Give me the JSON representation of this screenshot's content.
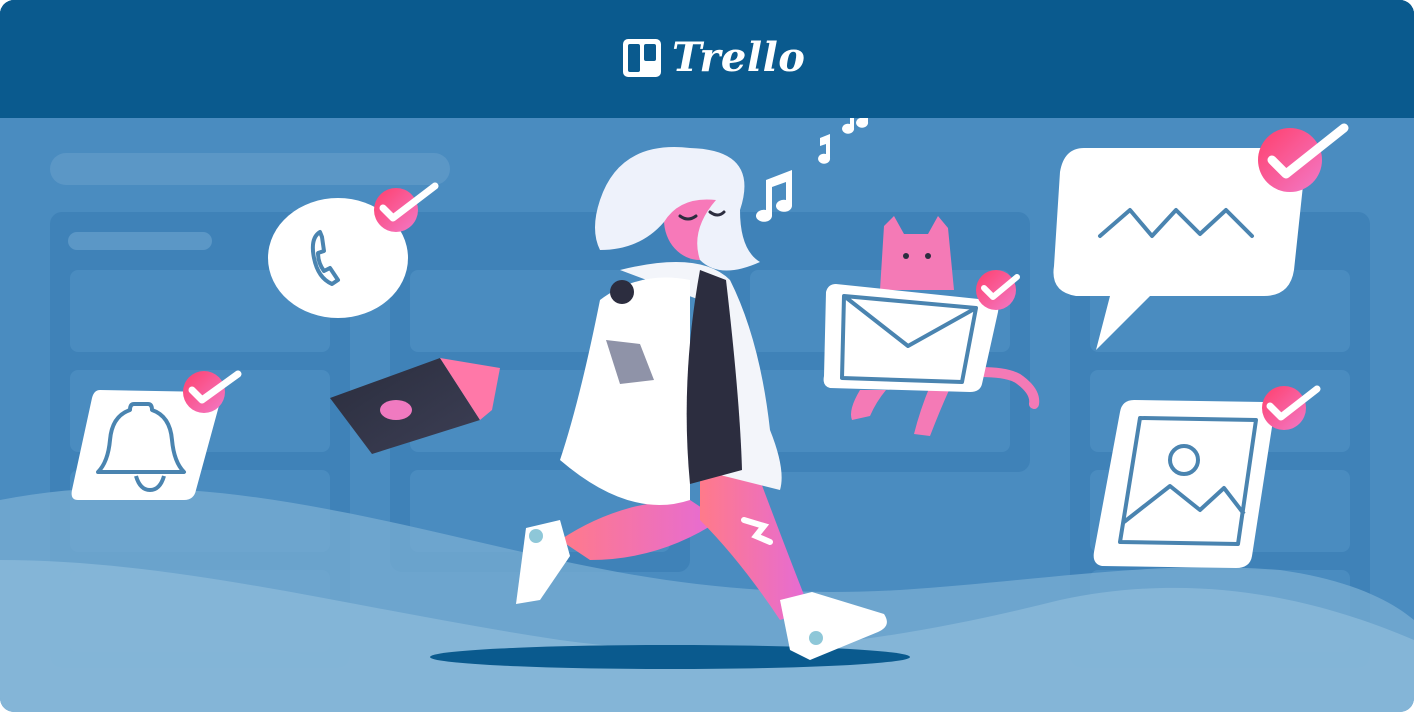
{
  "brand": {
    "name": "Trello",
    "logo_icon": "trello-board-icon"
  },
  "colors": {
    "header": "#0a5a8e",
    "board_background": "#4a8cc0",
    "accent_pink": "#f05a78",
    "card_white": "#ffffff"
  },
  "illustration": {
    "icons": [
      "phone-icon",
      "bell-icon",
      "laptop-icon",
      "envelope-icon",
      "cat-icon",
      "speech-bubble-icon",
      "image-icon",
      "checkmark-icon",
      "music-note-icon"
    ]
  }
}
